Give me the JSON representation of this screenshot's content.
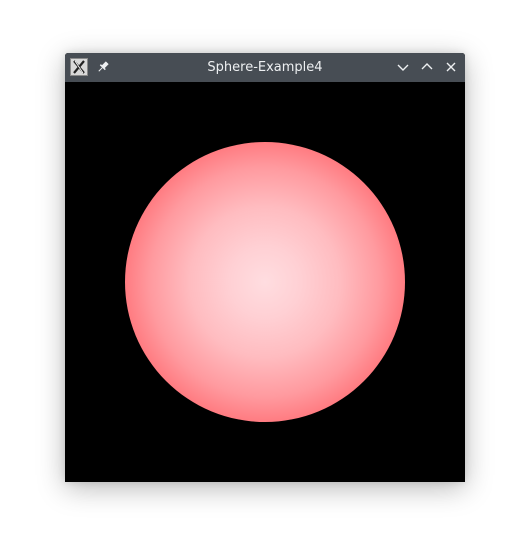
{
  "window": {
    "title": "Sphere-Example4",
    "icons": {
      "app": "x-app-icon",
      "pin": "pin-icon",
      "minimize": "chevron-down-icon",
      "maximize": "chevron-up-icon",
      "close": "close-icon"
    },
    "colors": {
      "titlebar": "#474d54",
      "title_text": "#eef0f2",
      "viewport_background": "#000000",
      "sphere_center": "#ffdde0",
      "sphere_edge": "#ff1a22"
    }
  }
}
